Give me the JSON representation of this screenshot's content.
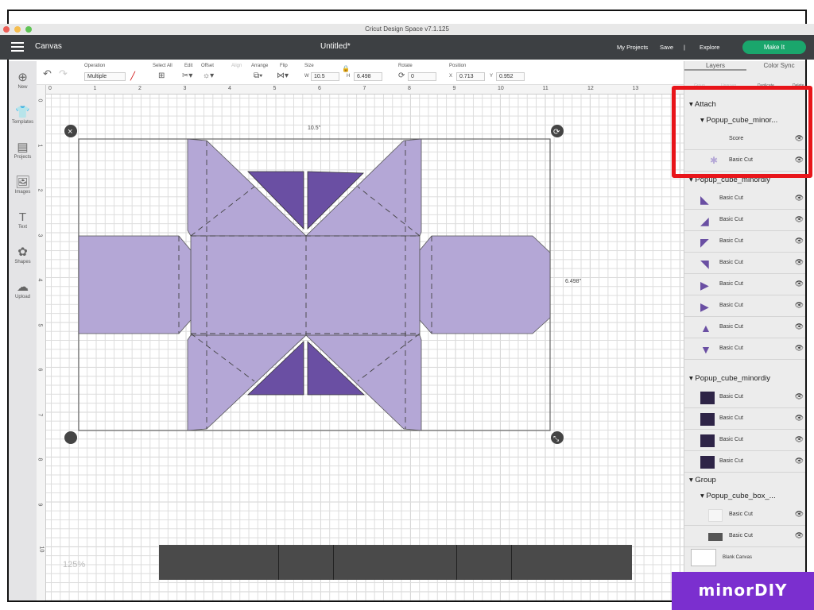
{
  "app_title": "Cricut Design Space  v7.1.125",
  "header": {
    "section": "Canvas",
    "doc_title": "Untitled*",
    "my_projects": "My Projects",
    "save": "Save",
    "separator": "|",
    "explore": "Explore",
    "make_it": "Make It"
  },
  "toolbar": {
    "operation_label": "Operation",
    "operation_value": "Multiple",
    "select_all": "Select All",
    "edit": "Edit",
    "offset": "Offset",
    "align": "Align",
    "arrange": "Arrange",
    "flip": "Flip",
    "size": "Size",
    "w_label": "W",
    "w_value": "10.5",
    "h_label": "H",
    "h_value": "6.498",
    "rotate": "Rotate",
    "rotate_value": "0",
    "position": "Position",
    "x_label": "X",
    "x_value": "0.713",
    "y_label": "Y",
    "y_value": "0.952"
  },
  "sidebar": [
    {
      "label": "New",
      "icon": "⊕"
    },
    {
      "label": "Templates",
      "icon": "👕"
    },
    {
      "label": "Projects",
      "icon": "▤"
    },
    {
      "label": "Images",
      "icon": "🖼"
    },
    {
      "label": "Text",
      "icon": "T"
    },
    {
      "label": "Shapes",
      "icon": "✿"
    },
    {
      "label": "Upload",
      "icon": "☁"
    }
  ],
  "ruler_x": [
    "0",
    "1",
    "2",
    "3",
    "4",
    "5",
    "6",
    "7",
    "8",
    "9",
    "10",
    "11",
    "12",
    "13"
  ],
  "ruler_y": [
    "0",
    "1",
    "2",
    "3",
    "4",
    "5",
    "6",
    "7",
    "8",
    "9",
    "10"
  ],
  "canvas": {
    "width_label": "10.5\"",
    "height_label": "6.498\"",
    "zoom": "125%",
    "shape_color": "#b4a7d6",
    "dark_color": "#6a4fa3"
  },
  "panel": {
    "tabs": [
      "Layers",
      "Color Sync"
    ],
    "actions": [
      "Group",
      "Ungroup",
      "Duplicate",
      "Delete"
    ],
    "attach": {
      "label": "Attach",
      "child": "Popup_cube_minor...",
      "items": [
        "Score",
        "Basic Cut"
      ]
    },
    "group1": {
      "label": "Popup_cube_minordiy",
      "items": [
        "Basic Cut",
        "Basic Cut",
        "Basic Cut",
        "Basic Cut",
        "Basic Cut",
        "Basic Cut",
        "Basic Cut",
        "Basic Cut"
      ]
    },
    "group2": {
      "label": "Popup_cube_minordiy",
      "items": [
        "Basic Cut",
        "Basic Cut",
        "Basic Cut",
        "Basic Cut"
      ]
    },
    "group3": {
      "label": "Group",
      "child": "Popup_cube_box_...",
      "items": [
        "Basic Cut",
        "Basic Cut"
      ]
    },
    "blank_canvas": "Blank Canvas"
  },
  "watermark": "minorDIY"
}
